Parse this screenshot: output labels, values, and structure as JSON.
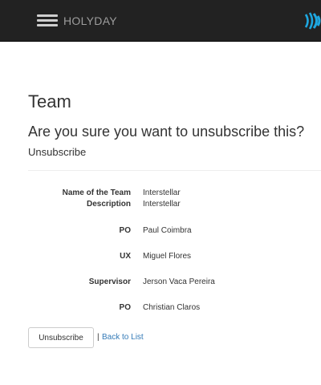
{
  "navbar": {
    "brand": "HOLYDAY",
    "menu_icon": "hamburger-menu-icon",
    "logo_icon": "brand-logo-icon",
    "background_color": "#222222",
    "logo_color": "#1ea7e0"
  },
  "page": {
    "title": "Team",
    "question": "Are you sure you want to unsubscribe this?",
    "section_title": "Unsubscribe"
  },
  "details": [
    {
      "label": "Name of the Team",
      "value": "Interstellar"
    },
    {
      "label": "Description",
      "value": "Interstellar"
    },
    {
      "label": "PO",
      "value": "Paul Coimbra"
    },
    {
      "label": "UX",
      "value": "Miguel Flores"
    },
    {
      "label": "Supervisor",
      "value": "Jerson Vaca Pereira"
    },
    {
      "label": "PO",
      "value": "Christian Claros"
    }
  ],
  "actions": {
    "unsubscribe_label": "Unsubscribe",
    "separator": "|",
    "back_link_label": "Back to List",
    "link_color": "#337ab7"
  }
}
